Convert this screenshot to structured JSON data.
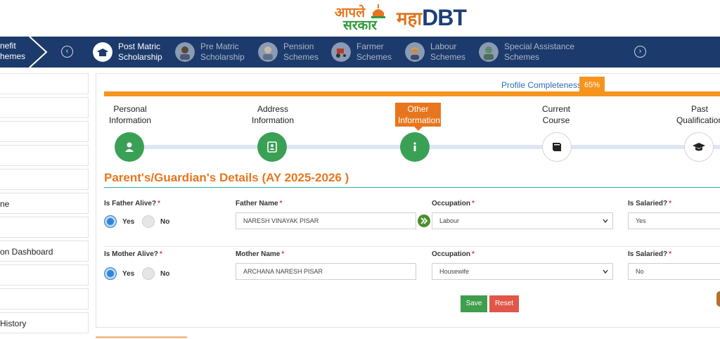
{
  "logos": {
    "aaple_sarkar_line1": "आपले",
    "aaple_sarkar_line2": "सरकार",
    "maha": "महा",
    "dbt": "DBT"
  },
  "navbar": {
    "first_line1": "nefit",
    "first_line2": "hemes",
    "items": [
      {
        "line1": "Post Matric",
        "line2": "Scholarship",
        "icon": "scholarship-icon",
        "active": true
      },
      {
        "line1": "Pre Matric",
        "line2": "Scholarship",
        "icon": "student-icon",
        "active": false
      },
      {
        "line1": "Pension",
        "line2": "Schemes",
        "icon": "elder-icon",
        "active": false
      },
      {
        "line1": "Farmer",
        "line2": "Schemes",
        "icon": "tractor-icon",
        "active": false
      },
      {
        "line1": "Labour",
        "line2": "Schemes",
        "icon": "labour-icon",
        "active": false
      },
      {
        "line1": "Special Assistance",
        "line2": "Schemes",
        "icon": "assistance-icon",
        "active": false
      }
    ],
    "prev_arrow": "‹",
    "next_arrow": "›"
  },
  "sidebar": {
    "items": [
      "",
      "",
      "",
      "",
      "",
      "ne",
      "",
      "on Dashboard",
      "",
      "",
      " History"
    ]
  },
  "profile": {
    "label": "Profile Completeness",
    "percent": "65%",
    "percent_value": 65
  },
  "steps": [
    {
      "line1": "Personal",
      "line2": "Information",
      "icon": "user-icon",
      "state": "done"
    },
    {
      "line1": "Address",
      "line2": "Information",
      "icon": "address-book-icon",
      "state": "done"
    },
    {
      "line1": "Other",
      "line2": "Information",
      "icon": "info-icon",
      "state": "active"
    },
    {
      "line1": "Current",
      "line2": "Course",
      "icon": "book-icon",
      "state": "todo"
    },
    {
      "line1": "Past",
      "line2": "Qualification",
      "icon": "graduation-cap-icon",
      "state": "todo"
    }
  ],
  "section": {
    "title": "Parent's/Guardian's Details (AY 2025-2026 )"
  },
  "father": {
    "alive_label": "Is Father Alive?",
    "yes": "Yes",
    "no": "No",
    "alive_value": "Yes",
    "name_label": "Father Name",
    "name_value": "NARESH VINAYAK PISAR",
    "occupation_label": "Occupation",
    "occupation_value": "Labour",
    "salaried_label": "Is Salaried?",
    "salaried_value": "Yes"
  },
  "mother": {
    "alive_label": "Is Mother Alive?",
    "yes": "Yes",
    "no": "No",
    "alive_value": "Yes",
    "name_label": "Mother Name",
    "name_value": "ARCHANA NARESH PISAR",
    "occupation_label": "Occupation",
    "occupation_value": "Housewife",
    "salaried_label": "Is Salaried?",
    "salaried_value": "No"
  },
  "required_mark": "*",
  "buttons": {
    "save": "Save",
    "reset": "Reset"
  },
  "colors": {
    "navbar": "#1c3a6b",
    "accent_orange": "#e8761e",
    "progress_orange": "#f7941d",
    "step_green": "#3aa055",
    "link_blue": "#2d6db5",
    "save_green": "#3f9d4b",
    "reset_red": "#e0574a"
  }
}
